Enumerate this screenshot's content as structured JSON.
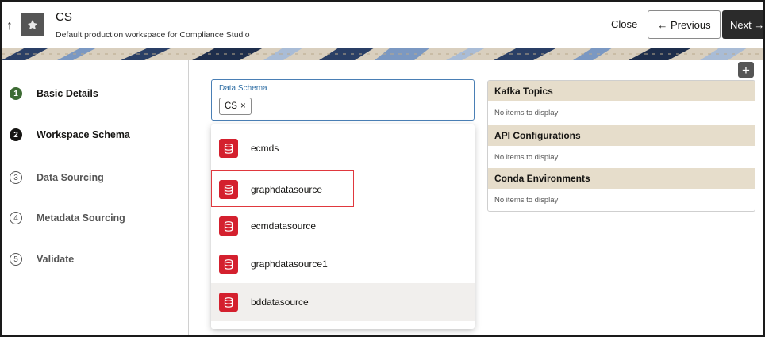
{
  "header": {
    "title": "CS",
    "subtitle": "Default production workspace for Compliance Studio",
    "close_label": "Close",
    "previous_label": "← Previous",
    "next_label": "Next →"
  },
  "steps": [
    {
      "number": "1",
      "label": "Basic Details",
      "state": "done"
    },
    {
      "number": "2",
      "label": "Workspace Schema",
      "state": "active"
    },
    {
      "number": "3",
      "label": "Data Sourcing",
      "state": "pending"
    },
    {
      "number": "4",
      "label": "Metadata Sourcing",
      "state": "pending"
    },
    {
      "number": "5",
      "label": "Validate",
      "state": "pending"
    }
  ],
  "schema": {
    "label": "Data Schema",
    "chip": "CS",
    "chip_remove": "×"
  },
  "options": [
    {
      "label": "ecmds"
    },
    {
      "label": "graphdatasource"
    },
    {
      "label": "ecmdatasource"
    },
    {
      "label": "graphdatasource1"
    },
    {
      "label": "bddatasource"
    }
  ],
  "add_label": "+",
  "panel": {
    "sections": [
      {
        "title": "Kafka Topics",
        "empty": "No items to display"
      },
      {
        "title": "API Configurations",
        "empty": "No items to display"
      },
      {
        "title": "Conda Environments",
        "empty": "No items to display"
      }
    ]
  },
  "colors": {
    "db_icon": "#d4202e",
    "step_done": "#3d6b33",
    "section_header": "#e6ddcb",
    "highlight": "#e0383e"
  }
}
